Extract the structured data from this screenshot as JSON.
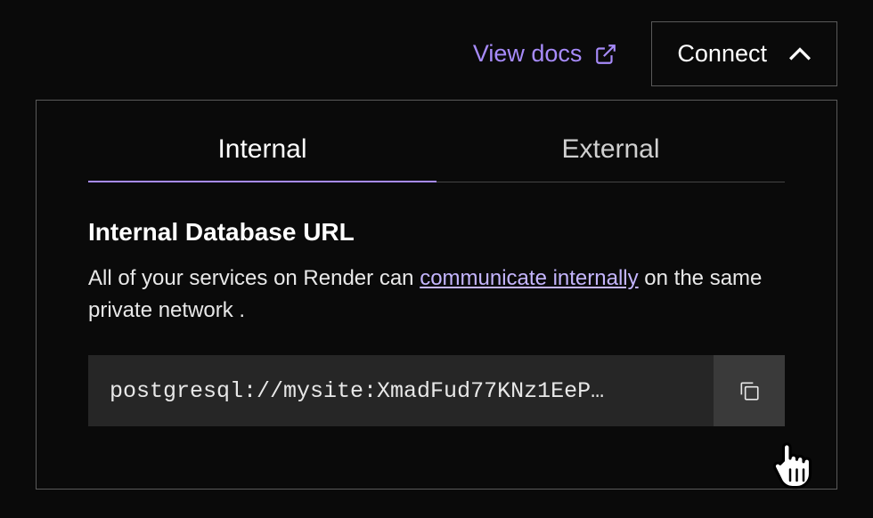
{
  "header": {
    "view_docs_label": "View docs",
    "connect_label": "Connect"
  },
  "tabs": {
    "internal_label": "Internal",
    "external_label": "External"
  },
  "section": {
    "title": "Internal Database URL",
    "desc_before": "All of your services on Render can ",
    "desc_link": "communicate internally",
    "desc_after": " on the same private network ."
  },
  "db": {
    "url": "postgresql://mysite:XmadFud77KNz1EeP…"
  },
  "colors": {
    "accent": "#a78bfa",
    "bg": "#0a0a0a",
    "panel_border": "#5a5a5a",
    "field_bg": "#262626",
    "copy_bg": "#3a3a3a"
  }
}
